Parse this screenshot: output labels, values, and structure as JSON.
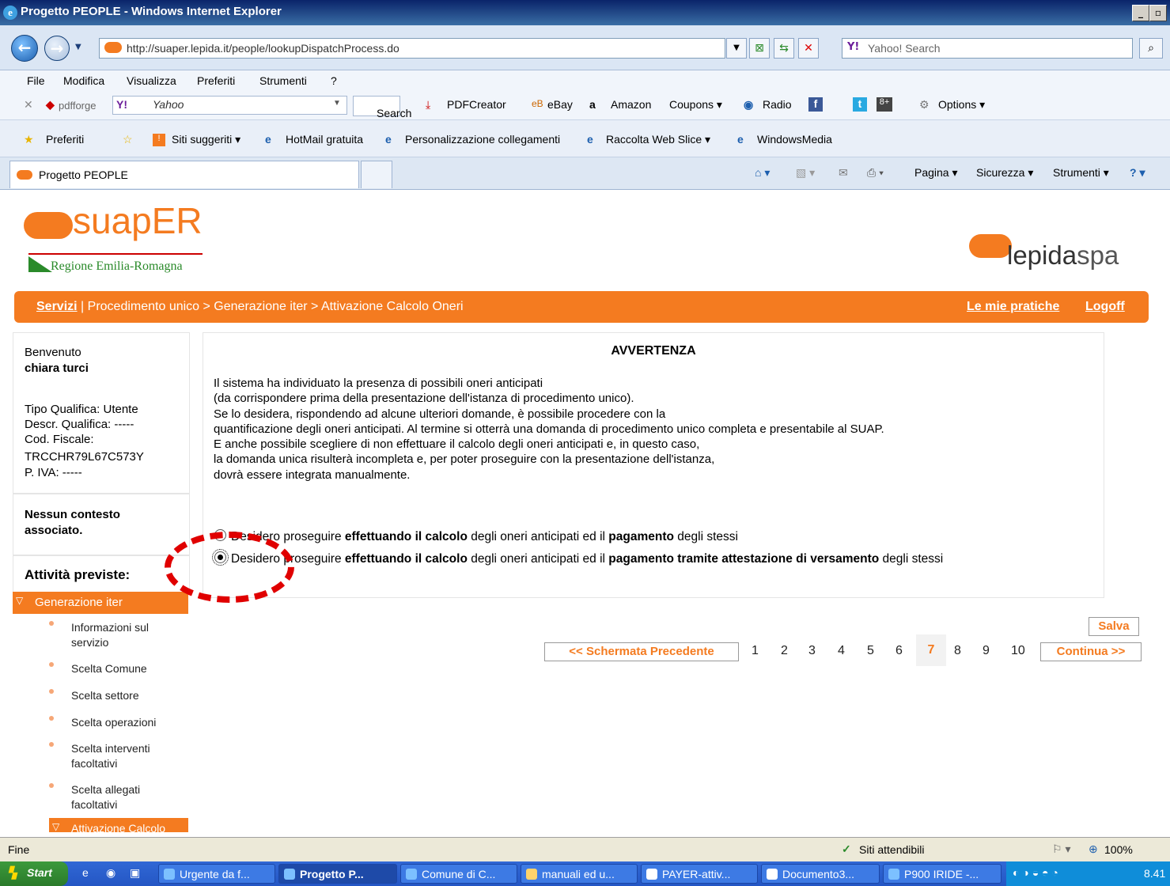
{
  "window": {
    "title": "Progetto PEOPLE - Windows Internet Explorer"
  },
  "address": {
    "url": "http://suaper.lepida.it/people/lookupDispatchProcess.do",
    "search_placeholder": "Yahoo! Search"
  },
  "menu": [
    "File",
    "Modifica",
    "Visualizza",
    "Preferiti",
    "Strumenti",
    "?"
  ],
  "toolbar": {
    "brand": "pdfforge",
    "yahoo": "Yahoo",
    "search": "Search",
    "pdfcreator": "PDFCreator",
    "ebay": "eBay",
    "amazon": "Amazon",
    "coupons": "Coupons ▾",
    "radio": "Radio",
    "options": "Options ▾"
  },
  "favorites": {
    "preferiti": "Preferiti",
    "items": [
      "Siti suggeriti ▾",
      "HotMail gratuita",
      "Personalizzazione collegamenti",
      "Raccolta Web Slice ▾",
      "WindowsMedia"
    ]
  },
  "tab": {
    "label": "Progetto PEOPLE"
  },
  "commands": {
    "pagina": "Pagina ▾",
    "sicurezza": "Sicurezza ▾",
    "strumenti": "Strumenti ▾"
  },
  "site": {
    "logo_text": "suapER",
    "region": "Regione Emilia-Romagna",
    "lepida_a": "lepida",
    "lepida_b": "spa",
    "nav": {
      "servizi": "Servizi",
      "crumb": "| Procedimento unico > Generazione iter > Attivazione Calcolo Oneri",
      "pratiche": "Le mie pratiche",
      "logoff": "Logoff"
    }
  },
  "user": {
    "welcome": "Benvenuto",
    "name": "chiara turci",
    "tipo": "Tipo Qualifica: Utente",
    "descr": "Descr. Qualifica: -----",
    "cf_label": "Cod. Fiscale:",
    "cf": "TRCCHR79L67C573Y",
    "piva": "P. IVA: -----",
    "contesto": "Nessun contesto associato.",
    "attivita": "Attività previste:"
  },
  "sidebar": {
    "section": "Generazione iter",
    "items": [
      "Informazioni sul servizio",
      "Scelta Comune",
      "Scelta settore",
      "Scelta operazioni",
      "Scelta interventi facoltativi",
      "Scelta allegati facoltativi"
    ],
    "active": "Attivazione Calcolo"
  },
  "main": {
    "heading": "AVVERTENZA",
    "text": "Il sistema ha individuato la presenza di possibili oneri anticipati\n(da corrispondere prima della presentazione dell'istanza di procedimento unico).\nSe lo desidera, rispondendo ad alcune ulteriori domande, è possibile procedere con la\nquantificazione degli oneri anticipati. Al termine si otterrà una domanda di procedimento unico completa e presentabile al SUAP.\nE anche possibile scegliere di non effettuare il calcolo degli oneri anticipati e, in questo caso,\nla domanda unica risulterà incompleta e, per poter proseguire con la presentazione dell'istanza,\ndovrà essere integrata manualmente.",
    "opt1": {
      "a": "Desidero proseguire ",
      "b": "effettuando il calcolo",
      "c": " degli oneri anticipati ed il ",
      "d": "pagamento",
      "e": " degli stessi"
    },
    "opt2": {
      "a": "Desidero proseguire ",
      "b": "effettuando il calcolo",
      "c": " degli oneri anticipati ed il ",
      "d": "pagamento tramite attestazione di versamento",
      "e": " degli stessi"
    },
    "selected_option": 2
  },
  "actions": {
    "salva": "Salva",
    "prev": "<< Schermata Precedente",
    "next": "Continua >>",
    "pages": [
      "1",
      "2",
      "3",
      "4",
      "5",
      "6",
      "7",
      "8",
      "9",
      "10"
    ],
    "current_page": "7"
  },
  "status": {
    "left": "Fine",
    "zone": "Siti attendibili",
    "zoom": "100%"
  },
  "taskbar": {
    "start": "Start",
    "tasks": [
      "Urgente da f...",
      "Progetto P...",
      "Comune di C...",
      "manuali ed u...",
      "PAYER-attiv...",
      "Documento3...",
      "P900 IRIDE -..."
    ],
    "clock": "8.41"
  },
  "colors": {
    "accent": "#f47b20",
    "title_bar": "#0a246a",
    "taskbar": "#2456c4",
    "annotation": "#e00000"
  }
}
